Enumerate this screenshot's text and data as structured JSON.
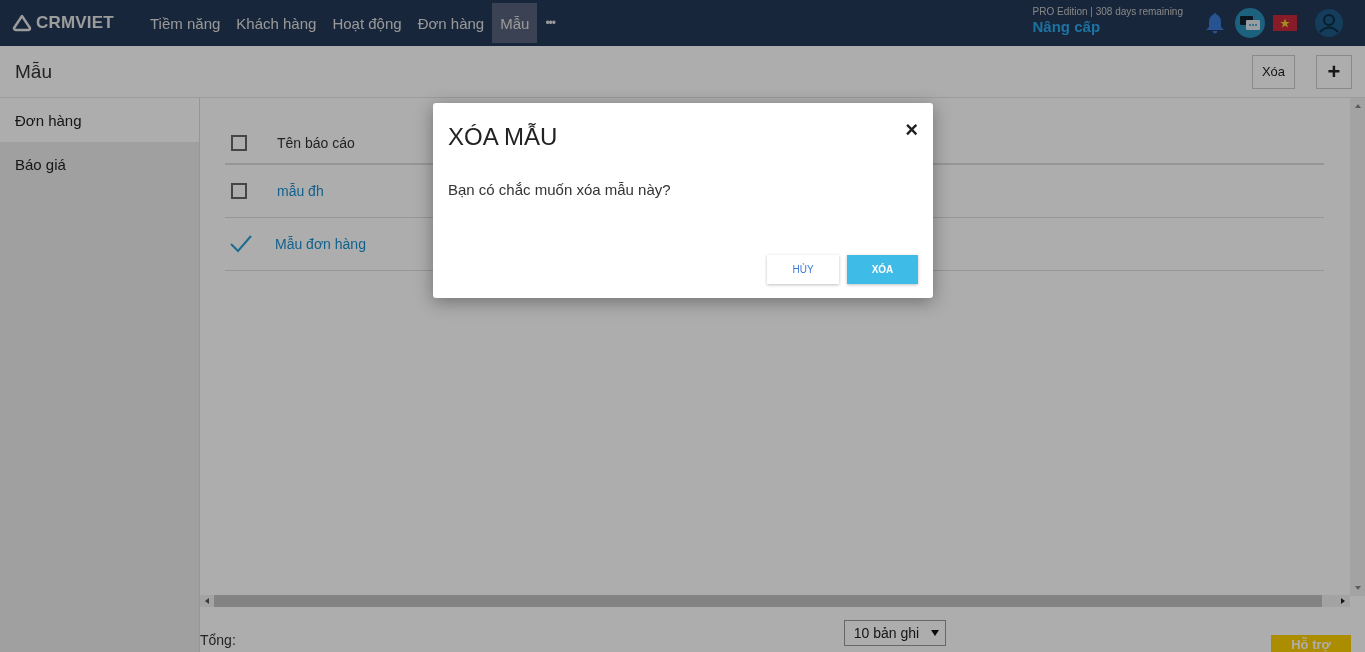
{
  "nav": {
    "brand": "CRMVIET",
    "items": [
      {
        "label": "Tiềm năng",
        "selected": false
      },
      {
        "label": "Khách hàng",
        "selected": false
      },
      {
        "label": "Hoạt động",
        "selected": false
      },
      {
        "label": "Đơn hàng",
        "selected": false
      },
      {
        "label": "Mẫu",
        "selected": true
      }
    ],
    "more": "•••",
    "edition": "PRO Edition | 308 days remaining",
    "upgrade": "Nâng cấp"
  },
  "page": {
    "title": "Mẫu",
    "actions": [
      {
        "label": "Xóa",
        "kind": "text"
      },
      {
        "label": "+",
        "kind": "icon"
      }
    ]
  },
  "sidebar": {
    "items": [
      {
        "label": "Đơn hàng",
        "selected": true
      },
      {
        "label": "Báo giá",
        "selected": false
      }
    ]
  },
  "table": {
    "header_checked": false,
    "columns": [
      "Tên báo cáo"
    ],
    "rows": [
      {
        "name": "mẫu đh",
        "checked": false
      },
      {
        "name": "Mẫu đơn hàng",
        "checked": true
      }
    ]
  },
  "footer": {
    "total_label": "Tổng:",
    "page_size": "10 bản ghi",
    "support": "Hỗ trợ"
  },
  "dialog": {
    "title": "XÓA MẪU",
    "close": "×",
    "message": "Bạn có chắc muốn xóa mẫu này?",
    "buttons": [
      {
        "label": "HỦY",
        "kind": "secondary"
      },
      {
        "label": "XÓA",
        "kind": "primary"
      }
    ]
  }
}
